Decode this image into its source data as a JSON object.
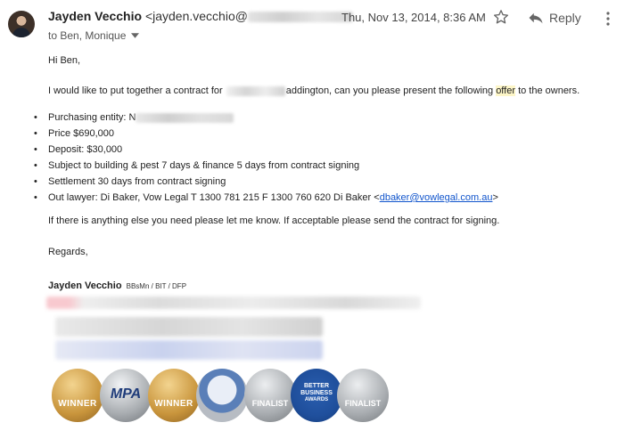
{
  "header": {
    "sender_name": "Jayden Vecchio",
    "sender_email_prefix": "<jayden.vecchio@",
    "date": "Thu, Nov 13, 2014, 8:36 AM",
    "reply_label": "Reply",
    "recipients": "to Ben, Monique"
  },
  "body": {
    "greeting": "Hi Ben,",
    "intro_part1": "I would like to put together a contract for",
    "intro_part2": "addington, can you please present the following",
    "intro_highlight": "offer",
    "intro_part3": "to the owners.",
    "bullets": {
      "entity_label": "Purchasing entity: N",
      "price": "Price $690,000",
      "deposit": "Deposit: $30,000",
      "subject": "Subject to building & pest 7 days & finance 5 days from contract signing",
      "settlement": "Settlement 30 days from contract signing",
      "lawyer": "Out lawyer: Di Baker, Vow Legal T 1300 781 215 F 1300 760 620 Di Baker <",
      "lawyer_email": "dbaker@vowlegal.com.au",
      "lawyer_close": ">"
    },
    "closing_line": "If there is anything else you need please let me know. If acceptable please send the contract for signing.",
    "regards": "Regards,"
  },
  "signature": {
    "name": "Jayden Vecchio",
    "qualifications": "BBsMn / BIT / DFP"
  },
  "awards": {
    "badge1": "WINNER",
    "badge2": "MPA",
    "badge3": "WINNER",
    "badge5": "FINALIST",
    "badge6_line1": "BETTER",
    "badge6_line2": "BUSINESS",
    "badge6_line3": "AWARDS",
    "badge7": "FINALIST"
  },
  "colors": {
    "link": "#1155cc",
    "highlight": "#fdf6c8",
    "gold": "#c9953c",
    "silver": "#a8acb0",
    "blue": "#1f4f9c"
  }
}
